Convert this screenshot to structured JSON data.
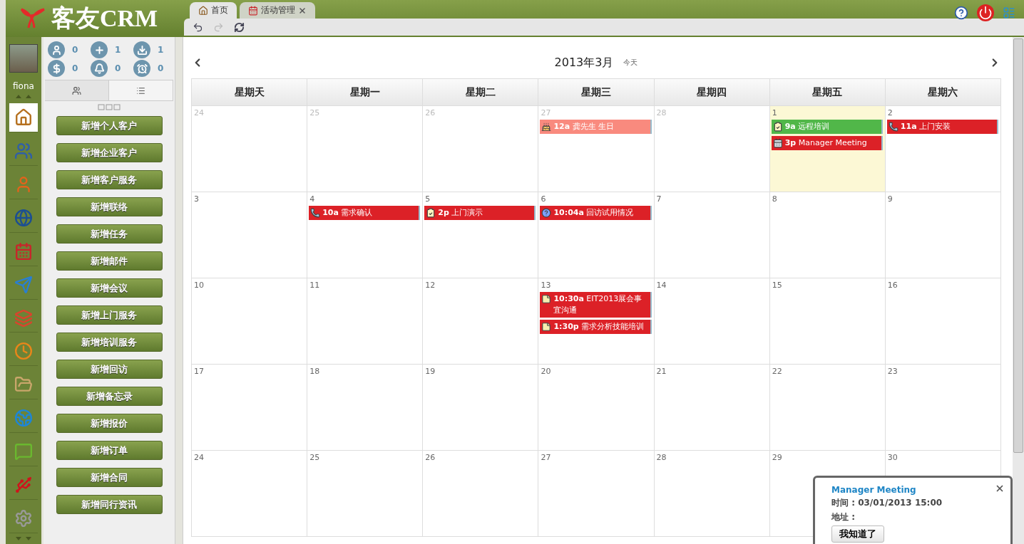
{
  "app": {
    "logo_text": "客友CRM"
  },
  "tabs": [
    {
      "label": "首页",
      "selected": true,
      "closable": false
    },
    {
      "label": "活动管理",
      "selected": false,
      "closable": true
    }
  ],
  "user": {
    "name": "fiona"
  },
  "stats": [
    {
      "count": "0"
    },
    {
      "count": "1"
    },
    {
      "count": "1"
    },
    {
      "count": "0"
    },
    {
      "count": "0"
    },
    {
      "count": "0"
    }
  ],
  "panel_tabs": [
    {
      "selected": true
    },
    {
      "selected": false
    }
  ],
  "nav_items": [
    {
      "selected": true
    },
    {
      "selected": false
    },
    {
      "selected": false
    },
    {
      "selected": false
    },
    {
      "selected": false
    },
    {
      "selected": false
    },
    {
      "selected": false
    },
    {
      "selected": false
    },
    {
      "selected": false
    },
    {
      "selected": false
    },
    {
      "selected": false
    },
    {
      "selected": false
    },
    {
      "selected": false
    }
  ],
  "quick_actions": [
    "新增个人客户",
    "新增企业客户",
    "新增客户服务",
    "新增联络",
    "新增任务",
    "新增邮件",
    "新增会议",
    "新增上门服务",
    "新增培训服务",
    "新增回访",
    "新增备忘录",
    "新增报价",
    "新增订单",
    "新增合同",
    "新增同行资讯"
  ],
  "calendar": {
    "title": "2013年3月",
    "today_label": "今天",
    "weekdays": [
      "星期天",
      "星期一",
      "星期二",
      "星期三",
      "星期四",
      "星期五",
      "星期六"
    ],
    "weeks": [
      [
        {
          "day": "24",
          "other_month": true,
          "today": false
        },
        {
          "day": "25",
          "other_month": true,
          "today": false
        },
        {
          "day": "26",
          "other_month": true,
          "today": false
        },
        {
          "day": "27",
          "other_month": true,
          "today": false,
          "events": [
            {
              "kind": "birthday",
              "time": "12a",
              "title": "龚先生 生日",
              "color": "#f98a7e"
            }
          ]
        },
        {
          "day": "28",
          "other_month": true,
          "today": false
        },
        {
          "day": "1",
          "other_month": false,
          "today": true,
          "events": [
            {
              "kind": "training",
              "time": "9a",
              "title": "远程培训",
              "color": "#51b749"
            },
            {
              "kind": "meeting",
              "time": "3p",
              "title": "Manager Meeting",
              "color": "#dc2127"
            }
          ]
        },
        {
          "day": "2",
          "other_month": false,
          "today": false,
          "events": [
            {
              "kind": "phone",
              "time": "11a",
              "title": "上门安装",
              "color": "#dc2127"
            }
          ]
        }
      ],
      [
        {
          "day": "3",
          "other_month": false,
          "today": false
        },
        {
          "day": "4",
          "other_month": false,
          "today": false,
          "events": [
            {
              "kind": "phone",
              "time": "10a",
              "title": "需求确认",
              "color": "#dc2127"
            }
          ]
        },
        {
          "day": "5",
          "other_month": false,
          "today": false,
          "events": [
            {
              "kind": "training",
              "time": "2p",
              "title": "上门演示",
              "color": "#dc2127"
            }
          ]
        },
        {
          "day": "6",
          "other_month": false,
          "today": false,
          "events": [
            {
              "kind": "question",
              "time": "10:04a",
              "title": "回访试用情况",
              "color": "#dc2127"
            }
          ]
        },
        {
          "day": "7",
          "other_month": false,
          "today": false
        },
        {
          "day": "8",
          "other_month": false,
          "today": false
        },
        {
          "day": "9",
          "other_month": false,
          "today": false
        }
      ],
      [
        {
          "day": "10",
          "other_month": false,
          "today": false
        },
        {
          "day": "11",
          "other_month": false,
          "today": false
        },
        {
          "day": "12",
          "other_month": false,
          "today": false
        },
        {
          "day": "13",
          "other_month": false,
          "today": false,
          "events": [
            {
              "kind": "note",
              "time": "10:30a",
              "title": "EIT2013展会事宜沟通",
              "color": "#dc2127"
            },
            {
              "kind": "note",
              "time": "1:30p",
              "title": "需求分析技能培训",
              "color": "#dc2127"
            }
          ]
        },
        {
          "day": "14",
          "other_month": false,
          "today": false
        },
        {
          "day": "15",
          "other_month": false,
          "today": false
        },
        {
          "day": "16",
          "other_month": false,
          "today": false
        }
      ],
      [
        {
          "day": "17",
          "other_month": false,
          "today": false
        },
        {
          "day": "18",
          "other_month": false,
          "today": false
        },
        {
          "day": "19",
          "other_month": false,
          "today": false
        },
        {
          "day": "20",
          "other_month": false,
          "today": false
        },
        {
          "day": "21",
          "other_month": false,
          "today": false
        },
        {
          "day": "22",
          "other_month": false,
          "today": false
        },
        {
          "day": "23",
          "other_month": false,
          "today": false
        }
      ],
      [
        {
          "day": "24",
          "other_month": false,
          "today": false
        },
        {
          "day": "25",
          "other_month": false,
          "today": false
        },
        {
          "day": "26",
          "other_month": false,
          "today": false
        },
        {
          "day": "27",
          "other_month": false,
          "today": false
        },
        {
          "day": "28",
          "other_month": false,
          "today": false
        },
        {
          "day": "29",
          "other_month": false,
          "today": false
        },
        {
          "day": "30",
          "other_month": false,
          "today": false
        }
      ]
    ]
  },
  "reminder": {
    "title": "Manager Meeting",
    "time_line": "时间 : 03/01/2013 15:00",
    "address_line": "地址 :",
    "button": "我知道了"
  }
}
